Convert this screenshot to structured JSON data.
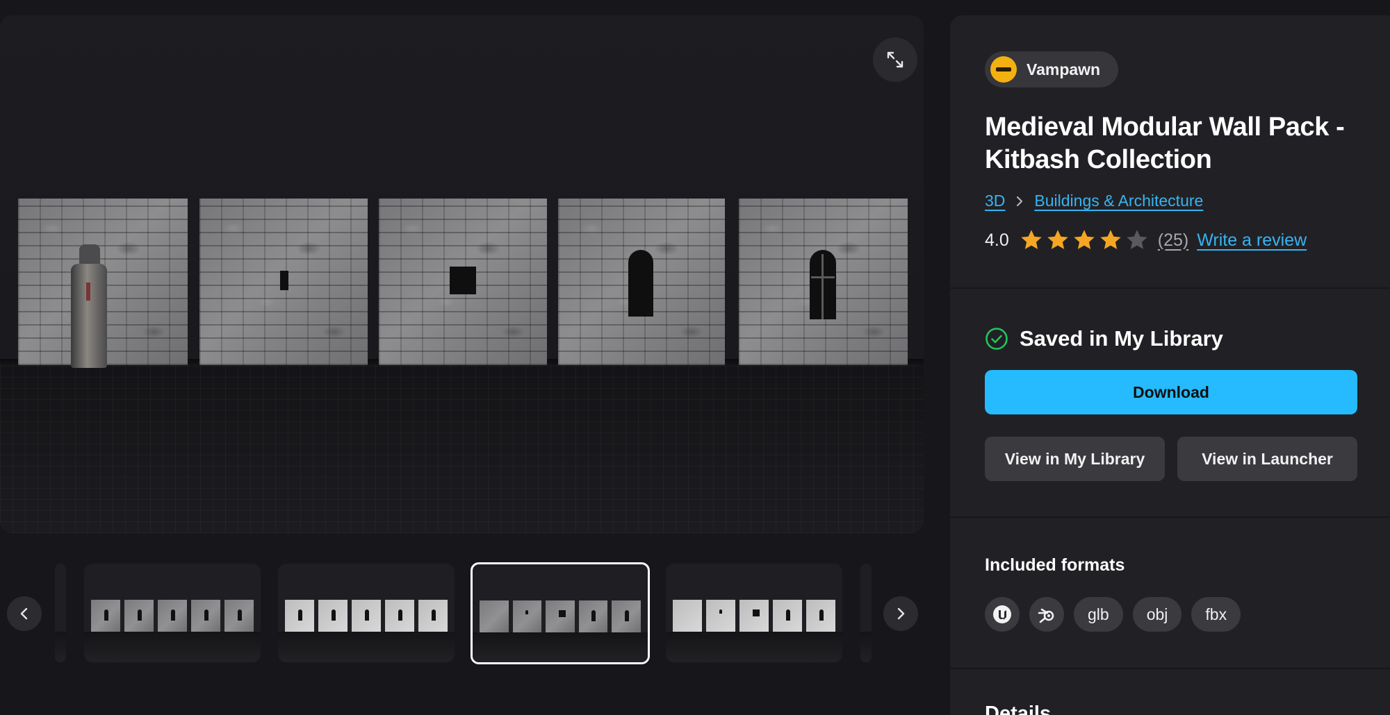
{
  "seller": {
    "name": "Vampawn"
  },
  "product": {
    "title": "Medieval Modular Wall Pack - Kitbash Collection",
    "breadcrumb": [
      "3D",
      "Buildings & Architecture"
    ],
    "rating": {
      "score": "4.0",
      "stars": 4,
      "max_stars": 5,
      "count": "(25)",
      "write_review": "Write a review"
    }
  },
  "library": {
    "status": "Saved in My Library",
    "download_label": "Download",
    "view_library_label": "View in My Library",
    "view_launcher_label": "View in Launcher"
  },
  "formats": {
    "title": "Included formats",
    "items": [
      {
        "type": "icon",
        "name": "unreal-engine-icon"
      },
      {
        "type": "icon",
        "name": "blender-icon"
      },
      {
        "type": "text",
        "label": "glb"
      },
      {
        "type": "text",
        "label": "obj"
      },
      {
        "type": "text",
        "label": "fbx"
      }
    ]
  },
  "details": {
    "title": "Details"
  },
  "gallery": {
    "selected_index": 2,
    "thumbnail_count": 4
  },
  "colors": {
    "accent": "#26bbff",
    "link": "#37b4f2",
    "star": "#f5a623",
    "star_empty": "#5a5a5e",
    "success": "#22c55e"
  }
}
